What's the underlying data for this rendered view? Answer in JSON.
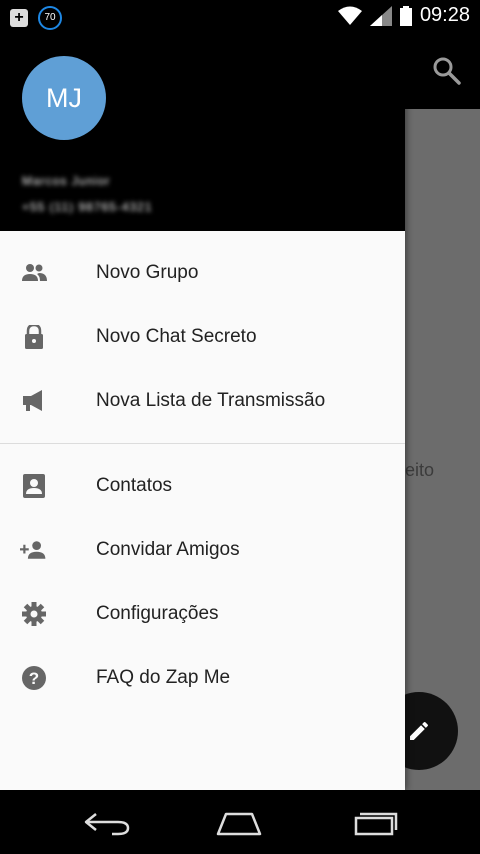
{
  "status_bar": {
    "badge": "70",
    "time": "09:28",
    "icons": [
      "notification-plus-icon",
      "counter-badge-icon",
      "wifi-icon",
      "signal-icon",
      "battery-icon"
    ]
  },
  "header": {
    "avatar_initials": "MJ",
    "avatar_color": "#5f9fd6",
    "user_name": "Marcos Junior",
    "user_phone": "+55 (11) 98765-4321"
  },
  "menu": {
    "group1": [
      {
        "label": "Novo Grupo",
        "icon": "group-icon"
      },
      {
        "label": "Novo Chat Secreto",
        "icon": "lock-icon"
      },
      {
        "label": "Nova Lista de Transmissão",
        "icon": "megaphone-icon"
      }
    ],
    "group2": [
      {
        "label": "Contatos",
        "icon": "contact-icon"
      },
      {
        "label": "Convidar Amigos",
        "icon": "add-person-icon"
      },
      {
        "label": "Configurações",
        "icon": "gear-icon"
      },
      {
        "label": "FAQ do Zap Me",
        "icon": "help-icon"
      }
    ]
  },
  "background": {
    "partial_text": "ireito"
  },
  "navigation": [
    "back-icon",
    "home-icon",
    "recents-icon"
  ]
}
